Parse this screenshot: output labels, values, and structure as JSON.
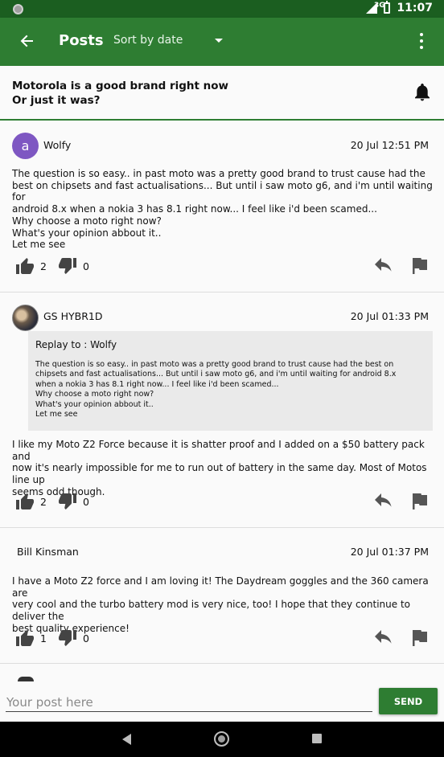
{
  "status_bar": {
    "network": "3G",
    "time": "11:07"
  },
  "app_bar": {
    "back_icon": "arrow-left-icon",
    "title": "Posts",
    "sort_label": "Sort by date",
    "menu_icon": "more-vert-icon"
  },
  "topic": {
    "title": "Motorola is a good brand right now\nOr just it was?",
    "bell_icon": "bell-icon"
  },
  "posts": [
    {
      "avatar_letter": "a",
      "author": "Wolfy",
      "date": "20 Jul  12:51 PM",
      "body": "The question is so easy.. in past moto was a pretty good brand to trust cause had the\nbest on chipsets and fast actualisations... But until i saw moto g6, and i'm until waiting for\nandroid 8.x when a nokia 3 has 8.1 right now... I feel like i'd been scamed...\nWhy choose a moto right now?\nWhat's your opinion abbout it..\nLet me see",
      "likes": "2",
      "dislikes": "0"
    },
    {
      "author": "GS HYBR1D",
      "date": "20 Jul  01:33 PM",
      "reply_header": "Replay to : Wolfy",
      "reply_quote": "The question is so easy.. in past moto was a pretty good brand to trust cause had the best on\nchipsets and fast actualisations... But until i saw moto g6, and i'm until waiting for android 8.x\nwhen a nokia 3 has 8.1 right now... I feel like i'd been scamed...\nWhy choose a moto right now?\nWhat's your opinion abbout it..\nLet me see",
      "body": "I like my Moto Z2 Force because it is shatter proof and I added on a $50 battery pack and\nnow it's nearly impossible for me to run out of battery in the same day. Most of Motos line up\nseems odd though.",
      "likes": "2",
      "dislikes": "0"
    },
    {
      "author": "Bill Kinsman",
      "date": "20 Jul  01:37 PM",
      "body": "I have a Moto Z2 force and I am loving it! The Daydream goggles and the 360 camera are\nvery cool and the turbo battery mod is very nice, too! I hope that they continue to deliver the\nbest quality experience!",
      "likes": "1",
      "dislikes": "0"
    }
  ],
  "composer": {
    "placeholder": "Your post here",
    "send_label": "SEND"
  },
  "colors": {
    "primary": "#2e7d32",
    "primary_dark": "#1b5e20",
    "avatar": "#7e57c2"
  }
}
